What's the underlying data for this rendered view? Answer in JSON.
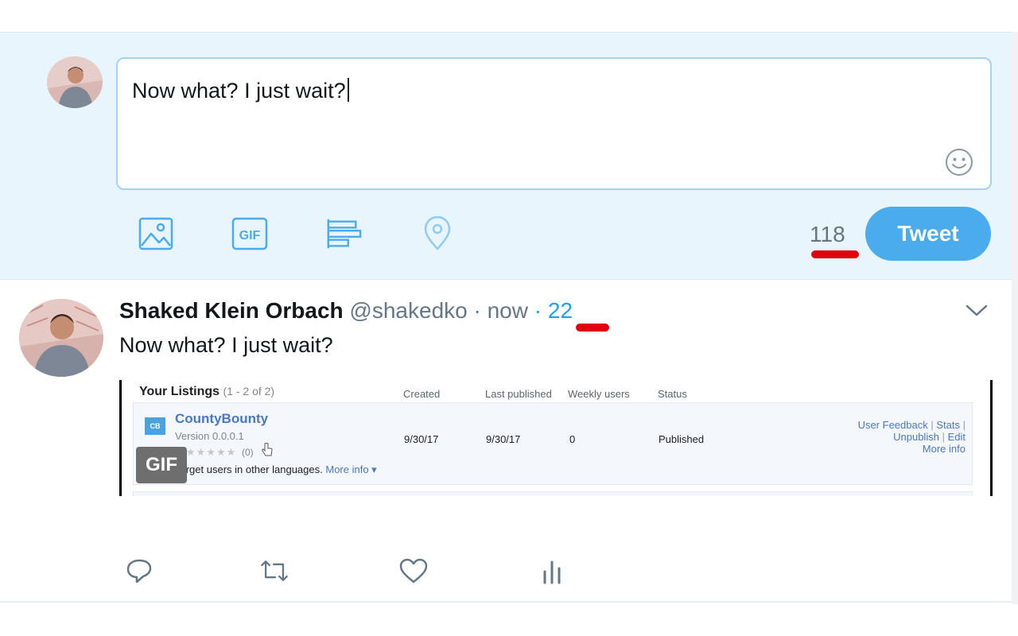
{
  "composer": {
    "input_value": "Now what? I just wait?",
    "char_count": "118",
    "tweet_label": "Tweet",
    "tools": [
      "image-icon",
      "gif-icon",
      "poll-icon",
      "location-icon"
    ],
    "emoji_icon": "smiley-icon"
  },
  "tweet": {
    "author_name": "Shaked Klein Orbach",
    "handle": "@shakedko",
    "separator": "·",
    "time": "now",
    "count": "22",
    "text": "Now what? I just wait?",
    "media": {
      "title": "Your Listings",
      "title_count": "(1 - 2 of 2)",
      "columns": [
        "Created",
        "Last published",
        "Weekly users",
        "Status"
      ],
      "app_icon_text": "CB",
      "app_name": "CountyBounty",
      "version": "Version 0.0.0.1",
      "stars": "★★★★★",
      "rating_count": "(0)",
      "target_text": "Target users in other languages.",
      "more_info_link": "More info ▾",
      "created": "9/30/17",
      "last_published": "9/30/17",
      "weekly_users": "0",
      "status": "Published",
      "actions": [
        "User Feedback",
        "Stats",
        "Unpublish",
        "Edit",
        "More info"
      ],
      "pipe": "|",
      "gif_badge": "GIF"
    },
    "action_icons": [
      "reply-icon",
      "retweet-icon",
      "like-icon",
      "analytics-icon"
    ]
  },
  "colors": {
    "accent": "#1da1f2",
    "tweet_button": "#4aabed",
    "composer_bg": "#e8f5fd",
    "annotation_red": "#e0000f"
  }
}
